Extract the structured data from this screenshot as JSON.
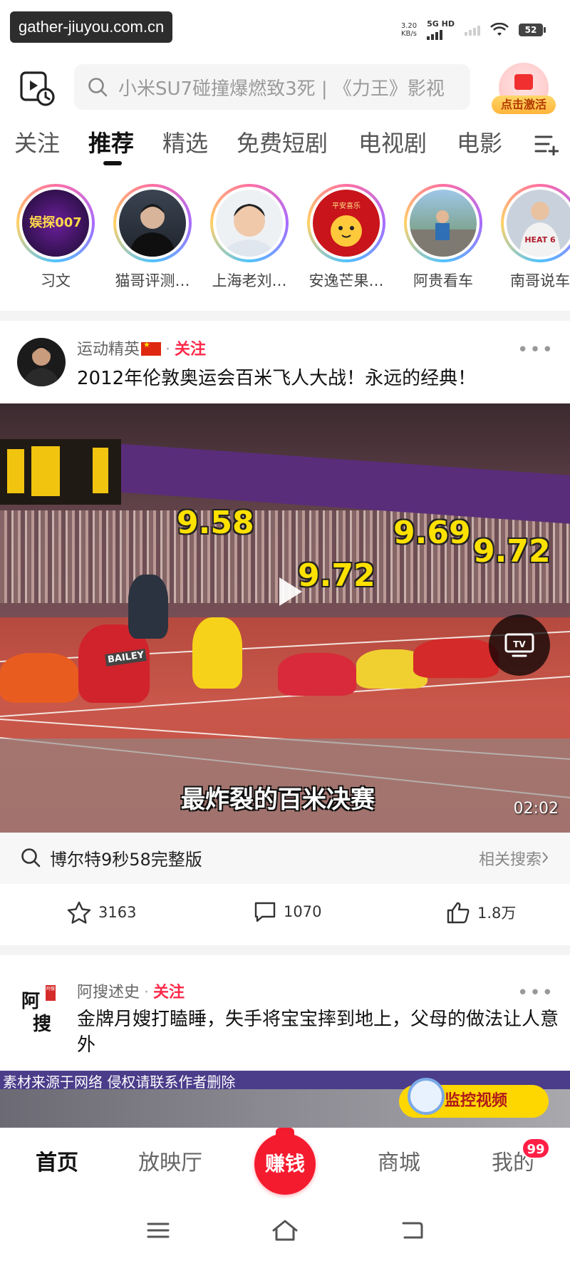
{
  "status_bar": {
    "watermark": "gather-jiuyou.com.cn",
    "net_speed_value": "3.20",
    "net_speed_unit": "KB/s",
    "network": "5G HD",
    "battery": "52"
  },
  "header": {
    "search_placeholder": "小米SU7碰撞爆燃致3死 | 《力王》影视",
    "activate_label": "点击激活"
  },
  "tabs": [
    {
      "label": "关注",
      "active": false
    },
    {
      "label": "推荐",
      "active": true
    },
    {
      "label": "精选",
      "active": false
    },
    {
      "label": "免费短剧",
      "active": false
    },
    {
      "label": "电视剧",
      "active": false
    },
    {
      "label": "电影",
      "active": false
    }
  ],
  "stories": [
    {
      "name": "习文",
      "avatar_text": "娱探007"
    },
    {
      "name": "猫哥评测…",
      "avatar_text": ""
    },
    {
      "name": "上海老刘…",
      "avatar_text": ""
    },
    {
      "name": "安逸芒果…",
      "avatar_text": "平安喜乐"
    },
    {
      "name": "阿贵看车",
      "avatar_text": ""
    },
    {
      "name": "南哥说车",
      "avatar_text": "HEAT 6"
    }
  ],
  "post1": {
    "author": "运动精英",
    "follow_label": "关注",
    "title": "2012年伦敦奥运会百米飞人大战！永远的经典！",
    "video": {
      "times": [
        "9.58",
        "9.69",
        "9.72",
        "9.72"
      ],
      "bib": "BAILEY",
      "caption": "最炸裂的百米决赛",
      "duration": "02:02"
    },
    "related_query": "博尔特9秒58完整版",
    "related_label": "相关搜索",
    "favorites": "3163",
    "comments": "1070",
    "likes": "1.8万"
  },
  "post2": {
    "author": "阿搜述史",
    "follow_label": "关注",
    "avatar_text_1": "阿",
    "avatar_text_2": "搜",
    "avatar_seal": "阿搜",
    "title": "金牌月嫂打瞌睡，失手将宝宝摔到地上，父母的做法让人意外",
    "video_note": "素材来源于网络 侵权请联系作者删除",
    "video_badge": "监控视频"
  },
  "bottom_nav": {
    "home": "首页",
    "theater": "放映厅",
    "earn": "赚钱",
    "mall": "商城",
    "me": "我的",
    "me_badge": "99"
  },
  "colors": {
    "accent": "#ff2a4a",
    "earn_button": "#f51b2e",
    "search_bg": "#f5f5f5",
    "divider": "#f4f4f4"
  }
}
